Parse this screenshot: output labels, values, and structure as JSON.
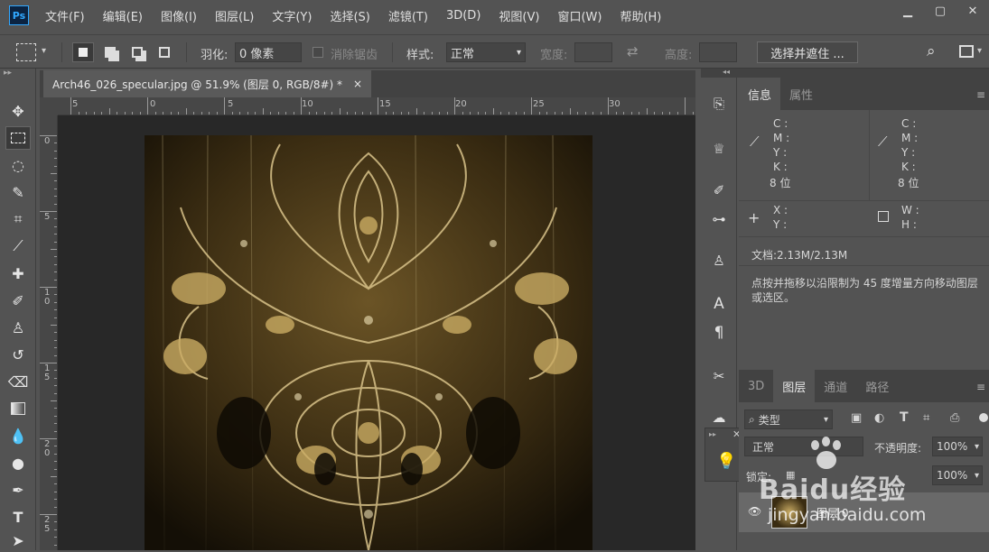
{
  "app_logo_text": "Ps",
  "menu": [
    "文件(F)",
    "编辑(E)",
    "图像(I)",
    "图层(L)",
    "文字(Y)",
    "选择(S)",
    "滤镜(T)",
    "3D(D)",
    "视图(V)",
    "窗口(W)",
    "帮助(H)"
  ],
  "options": {
    "feather_label": "羽化:",
    "feather_value": "0 像素",
    "antialias_label": "消除锯齿",
    "style_label": "样式:",
    "style_value": "正常",
    "width_label": "宽度:",
    "height_label": "高度:",
    "select_mask_button": "选择并遮住 ..."
  },
  "document_tab": {
    "title": "Arch46_026_specular.jpg @ 51.9% (图层 0, RGB/8#) *",
    "close": "×"
  },
  "ruler": {
    "h_labels": [
      "5",
      "0",
      "5",
      "10",
      "15",
      "20",
      "25",
      "30"
    ],
    "v_labels": [
      "0",
      "5",
      "1\n0",
      "1\n5",
      "2\n0",
      "2\n5"
    ]
  },
  "info_panel": {
    "tabs": [
      "信息",
      "属性"
    ],
    "cmyk_left": [
      "C :",
      "M :",
      "Y :",
      "K :"
    ],
    "cmyk_right": [
      "C :",
      "M :",
      "Y :",
      "K :"
    ],
    "bit_left": "8 位",
    "bit_right": "8 位",
    "xy": [
      "X :",
      "Y :"
    ],
    "wh": [
      "W :",
      "H :"
    ],
    "doc_size": "文档:2.13M/2.13M",
    "hint": "点按并拖移以沿限制为 45 度增量方向移动图层或选区。"
  },
  "layers_panel": {
    "tabs": [
      "3D",
      "图层",
      "通道",
      "路径"
    ],
    "filter_kind": "类型",
    "blend_mode": "正常",
    "opacity_label": "不透明度:",
    "opacity_value": "100%",
    "lock_label": "锁定:",
    "fill_value": "100%",
    "layer_name": "图层 0"
  },
  "watermark": {
    "brand": "Baidu经验",
    "url": "jingyan.baidu.com"
  },
  "colors": {
    "chrome": "#535353",
    "dark_chrome": "#424242",
    "canvas_bg": "#282828",
    "accent": "#31a8ff"
  }
}
